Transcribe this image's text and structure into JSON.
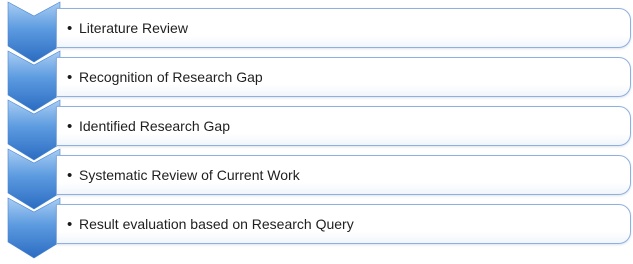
{
  "steps": [
    {
      "label": "Literature Review"
    },
    {
      "label": "Recognition of Research Gap"
    },
    {
      "label": "Identified Research Gap"
    },
    {
      "label": "Systematic Review of Current Work"
    },
    {
      "label": "Result evaluation based on Research Query"
    }
  ],
  "bullet_glyph": "•",
  "colors": {
    "chevron_light": "#9cc3ee",
    "chevron_dark": "#2d6fc4",
    "box_border": "#8eb0e0"
  }
}
